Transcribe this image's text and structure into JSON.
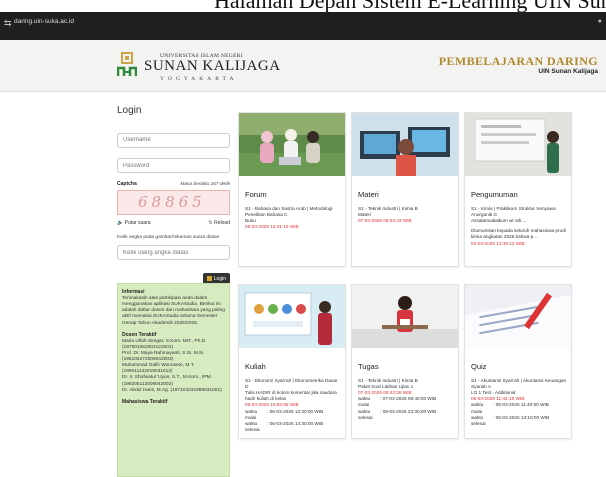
{
  "caption": "Halaman Depan Sistem E-Learning UIN Sun",
  "browser": {
    "url": "daring.uin-suka.ac.id"
  },
  "header": {
    "uni_top": "UNIVERSITAS ISLAM NEGERI",
    "uni_name": "SUNAN KALIJAGA",
    "uni_city": "YOGYAKARTA",
    "brand_title": "PEMBELAJARAN DARING",
    "brand_sub": "UIN Sunan Kalijaga"
  },
  "login": {
    "title": "Login",
    "username_placeholder": "Username",
    "password_placeholder": "Password",
    "captcha_label": "Captcha",
    "captcha_timer": "Masa berlaku 167 detik",
    "captcha_code": "68865",
    "play_sound": "Putar suara",
    "reload": "Reload",
    "captcha_help": "Ketik angka pada gambar/rekaman suara diatas",
    "captcha_placeholder": "Ketik ulang angka diatas",
    "login_button": "Login"
  },
  "info": {
    "title": "Informasi",
    "text": "Terimakasih atas partisipasi anda dalam menggunakan aplikasi SUKAstudia. Berikut ini adalah daftar dosen dan mahasiswa yang paling aktif memakai SUKAstudia selama Semester Genap Tahun Akademik 2025/2026.",
    "lecturers_title": "Dosen Teraktif",
    "lecturers": [
      "Maria Ulfah Siregar, S.Kom. MIT., Ph.D. (197801062002122001)",
      "Prof. Dr. Maya Rahmayanti, S.Si. M.Si. (198106272006042003)",
      "Muhammad Galih Wonoseto, M.T. (199011132019031012)",
      "Dr. Ir. Shofwatul 'Uyun, S.T., M.Kom., IPM. (198205112006042002)",
      "Dr. Abdul Haris, M.Ag. (197104231999031001)"
    ],
    "students_title": "Mahasiswa Teraktif"
  },
  "cards": [
    {
      "title": "Forum",
      "lines": [
        "S1 - Bahasa dan Sastra Arab | Metodologi Penelitian Bahasa C",
        "Buku"
      ],
      "date": "05-03-2026 12:41:15 WIB"
    },
    {
      "title": "Materi",
      "lines": [
        "S1 - Teknik Industri | Kimia B",
        "Materi"
      ],
      "date": "07-03-2026 08:04:43 WIB"
    },
    {
      "title": "Pengumuman",
      "lines": [
        "S1 - Kimia | Praktikum Struktur Senyawa Anorganik G",
        "Assalamualaikum wr wb....",
        "",
        "Diumumkan kepada seluruh mahasiswa prodi kimia angkatan 2025 bahwa p..."
      ],
      "date": "04-03-2026 13:39:12 WIB"
    },
    {
      "title": "Kuliah",
      "lines": [
        "S1 - Ekonomi Syari'ah | Ekonometrika Dasar D",
        "Tulis HADIR di kolom komentar jika saudara hadir kuliah di kelas"
      ],
      "date": "06-03-2026 15:56:56 WIB",
      "kv": [
        {
          "k": "waktu mulai",
          "v": ": 06-03-2026 12:30:00 WIB"
        },
        {
          "k": "waktu selesai",
          "v": ": 06-03-2026 14:30:00 WIB"
        }
      ]
    },
    {
      "title": "Tugas",
      "lines": [
        "S1 - Teknik Industri | Kimia B",
        "Paket Soal Latihan Ujian 1"
      ],
      "date": "07-03-2026 08:43:26 WIB",
      "kv": [
        {
          "k": "waktu mulai",
          "v": ": 07-03-2026 08:40:00 WIB"
        },
        {
          "k": "waktu selesai",
          "v": ": 09-03-2026 23:30:00 WIB"
        }
      ]
    },
    {
      "title": "Quiz",
      "lines": [
        "S1 - Akuntansi Syari'ah | Akuntansi Keuangan Syariah A",
        "LO 1 Test - Additional"
      ],
      "date": "05-03-2026 11:44:19 WIB",
      "kv": [
        {
          "k": "waktu mulai",
          "v": ": 05-03-2026 11:40:00 WIB"
        },
        {
          "k": "waktu selesai",
          "v": ": 05-03-2026 13:10:00 WIB"
        }
      ]
    }
  ],
  "colors": {
    "accent_gold": "#b08a2e",
    "info_bg": "#d7ebc1",
    "date_red": "#dd3333"
  }
}
